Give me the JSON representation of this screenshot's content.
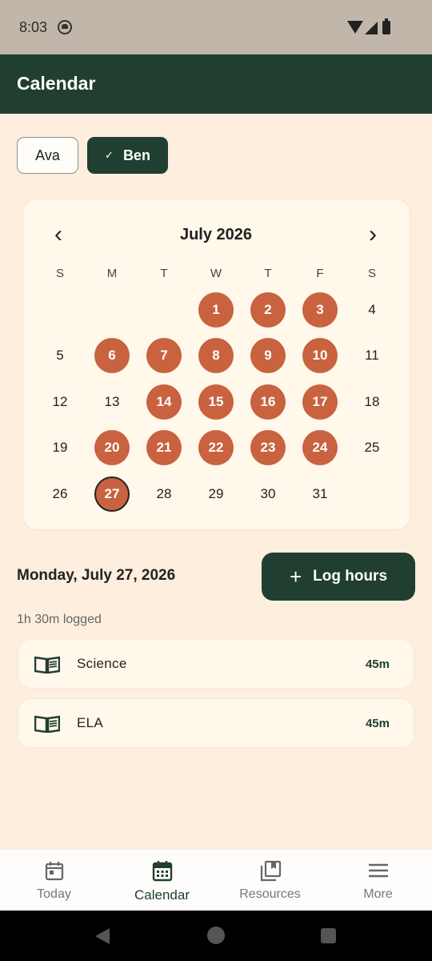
{
  "status_bar": {
    "time": "8:03"
  },
  "app_bar": {
    "title": "Calendar"
  },
  "students": [
    {
      "name": "Ava",
      "selected": false
    },
    {
      "name": "Ben",
      "selected": true
    }
  ],
  "calendar": {
    "month_label": "July 2026",
    "weekdays": [
      "S",
      "M",
      "T",
      "W",
      "T",
      "F",
      "S"
    ],
    "days": [
      "1",
      "2",
      "3",
      "4",
      "5",
      "6",
      "7",
      "8",
      "9",
      "10",
      "11",
      "12",
      "13",
      "14",
      "15",
      "16",
      "17",
      "18",
      "19",
      "20",
      "21",
      "22",
      "23",
      "24",
      "25",
      "26",
      "27",
      "28",
      "29",
      "30",
      "31"
    ],
    "logged_days": [
      1,
      2,
      3,
      6,
      7,
      8,
      9,
      10,
      14,
      15,
      16,
      17,
      20,
      21,
      22,
      23,
      24,
      27
    ],
    "today": 27
  },
  "selected_day": {
    "date_label": "Monday, July 27, 2026",
    "total_logged": "1h 30m logged",
    "log_button_label": "Log hours",
    "entries": [
      {
        "subject": "Science",
        "duration": "45m"
      },
      {
        "subject": "ELA",
        "duration": "45m"
      }
    ]
  },
  "bottom_nav": [
    {
      "label": "Today",
      "icon": "calendar-today-icon",
      "active": false
    },
    {
      "label": "Calendar",
      "icon": "calendar-month-icon",
      "active": true
    },
    {
      "label": "Resources",
      "icon": "library-books-icon",
      "active": false
    },
    {
      "label": "More",
      "icon": "menu-icon",
      "active": false
    }
  ],
  "colors": {
    "primary": "#203f30",
    "logged_day": "#c9623f",
    "background": "#fdeedd",
    "card": "#fff8eb"
  }
}
